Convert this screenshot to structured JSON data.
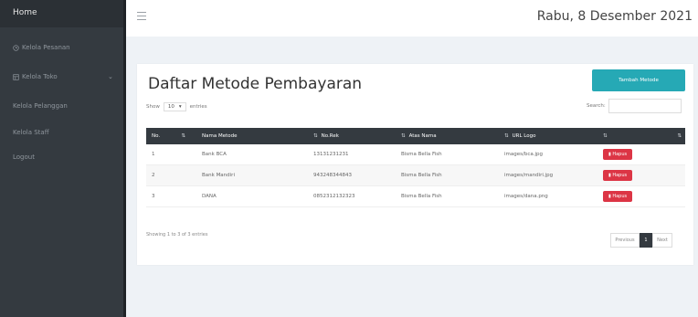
{
  "sidebar": {
    "home": "Home",
    "items": [
      {
        "label": "Kelola Pesanan",
        "icon": "clock-icon"
      },
      {
        "label": "Kelola Toko",
        "icon": "table-icon",
        "has_chevron": true
      },
      {
        "label": "Kelola Pelanggan"
      },
      {
        "label": "Kelola Staff"
      },
      {
        "label": "Logout"
      }
    ]
  },
  "topbar": {
    "date": "Rabu, 8 Desember 2021"
  },
  "main": {
    "title": "Daftar Metode Pembayaran",
    "add_button": "Tambah Metode",
    "show_prefix": "Show",
    "show_value": "10",
    "show_suffix": "entries",
    "search_label": "Search:",
    "search_value": "",
    "table": {
      "headers": [
        "No.",
        "Nama Metode",
        "No.Rek",
        "Atas Nama",
        "URL Logo",
        ""
      ],
      "rows": [
        {
          "no": "1",
          "nama": "Bank BCA",
          "norek": "13131231231",
          "atas_nama": "Bisma Bella Fish",
          "url": "images/bca.jpg",
          "action": "Hapus"
        },
        {
          "no": "2",
          "nama": "Bank Mandiri",
          "norek": "943248344843",
          "atas_nama": "Bisma Bella Fish",
          "url": "images/mandiri.jpg",
          "action": "Hapus"
        },
        {
          "no": "3",
          "nama": "DANA",
          "norek": "0852312132323",
          "atas_nama": "Bisma Bella Fish",
          "url": "images/dana.png",
          "action": "Hapus"
        }
      ]
    },
    "info": "Showing 1 to 3 of 3 entries",
    "pagination": {
      "prev": "Previous",
      "current": "1",
      "next": "Next"
    }
  },
  "colors": {
    "sidebar": "#343a40",
    "accent": "#26a9b5",
    "danger": "#dc3545",
    "background": "#eef2f6"
  }
}
